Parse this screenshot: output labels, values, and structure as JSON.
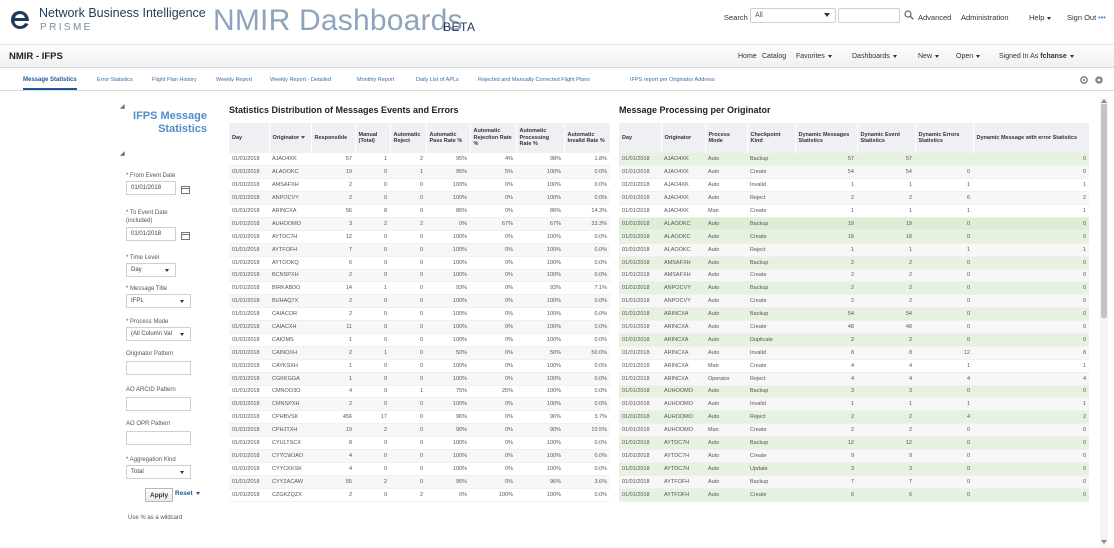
{
  "header": {
    "brand_name": "Network Business Intelligence",
    "brand_sub": "PRISME",
    "app_title": "NMIR Dashboards",
    "app_beta": "BETA",
    "search_label": "Search",
    "search_scope": "All",
    "advanced": "Advanced",
    "administration": "Administration",
    "help": "Help",
    "sign_out": "Sign Out",
    "more": "•••"
  },
  "nav": {
    "page_name": "NMIR - IFPS",
    "home": "Home",
    "catalog": "Catalog",
    "favorites": "Favorites",
    "dashboards": "Dashboards",
    "new": "New",
    "open": "Open",
    "signed_in_as": "Signed In As",
    "user": "fchanse"
  },
  "tabs": [
    "Message Statistics",
    "Error Statistics",
    "Flight Plan History",
    "Weekly Report",
    "Weekly Report - Detailed",
    "Monthly Report",
    "Daily List of APLs",
    "Rejected and Manually Corrected Flight Plans",
    "IFPS report per Originator Address"
  ],
  "filters": {
    "title_line1": "IFPS Message",
    "title_line2": "Statistics",
    "from_label": "* From Event Date",
    "from_value": "01/01/2018",
    "to_label_1": "* To Event Date",
    "to_label_2": "(included)",
    "to_value": "01/01/2018",
    "time_level_label": "* Time Level",
    "time_level_value": "Day",
    "message_title_label": "* Message Title",
    "message_title_value": "IFPL",
    "process_mode_label": "* Process Mode",
    "process_mode_value": "(All Column Val",
    "originator_label": "Originator Pattern",
    "arcid_label": "AO ARCID Pattern",
    "opr_label": "AO OPR Pattern",
    "aggregation_label": "* Aggregation Kind",
    "aggregation_value": "Total",
    "apply": "Apply",
    "reset": "Reset",
    "hint": "Use % as a wildcard"
  },
  "table1": {
    "title": "Statistics Distribution of Messages Events and Errors",
    "headers": [
      "Day",
      "Originator",
      "Responsible",
      "Manual (Total)",
      "Automatic Reject",
      "Automatic Pass Rate %",
      "Automatic Rejection Rate %",
      "Automatic Processing Rate %",
      "Automatic Invalid Rate %"
    ],
    "rows": [
      [
        "01/01/2018",
        "AJAO4XK",
        "57",
        "1",
        "2",
        "95%",
        "4%",
        "98%",
        "1.8%"
      ],
      [
        "01/01/2018",
        "ALAOOKC",
        "19",
        "0",
        "1",
        "95%",
        "5%",
        "100%",
        "0.0%"
      ],
      [
        "01/01/2018",
        "AMSAFXH",
        "2",
        "0",
        "0",
        "100%",
        "0%",
        "100%",
        "0.0%"
      ],
      [
        "01/01/2018",
        "ANPOCVY",
        "2",
        "0",
        "0",
        "100%",
        "0%",
        "100%",
        "0.0%"
      ],
      [
        "01/01/2018",
        "ARINCXA",
        "56",
        "8",
        "0",
        "86%",
        "0%",
        "86%",
        "14.3%"
      ],
      [
        "01/01/2018",
        "AUHOOMO",
        "3",
        "2",
        "2",
        "0%",
        "67%",
        "67%",
        "33.3%"
      ],
      [
        "01/01/2018",
        "AYTDC7H",
        "12",
        "0",
        "0",
        "100%",
        "0%",
        "100%",
        "0.0%"
      ],
      [
        "01/01/2018",
        "AYTFOFH",
        "7",
        "0",
        "0",
        "100%",
        "0%",
        "100%",
        "0.0%"
      ],
      [
        "01/01/2018",
        "AYTOOKQ",
        "6",
        "0",
        "0",
        "100%",
        "0%",
        "100%",
        "0.0%"
      ],
      [
        "01/01/2018",
        "BCNSPXH",
        "2",
        "0",
        "0",
        "100%",
        "0%",
        "100%",
        "0.0%"
      ],
      [
        "01/01/2018",
        "BIRKABDO",
        "14",
        "1",
        "0",
        "93%",
        "0%",
        "93%",
        "7.1%"
      ],
      [
        "01/01/2018",
        "BUHAQ7X",
        "2",
        "0",
        "0",
        "100%",
        "0%",
        "100%",
        "0.0%"
      ],
      [
        "01/01/2018",
        "CAIACOR",
        "2",
        "0",
        "0",
        "100%",
        "0%",
        "100%",
        "0.0%"
      ],
      [
        "01/01/2018",
        "CAIACXH",
        "11",
        "0",
        "0",
        "100%",
        "0%",
        "100%",
        "0.0%"
      ],
      [
        "01/01/2018",
        "CAIOMS",
        "1",
        "0",
        "0",
        "100%",
        "0%",
        "100%",
        "0.0%"
      ],
      [
        "01/01/2018",
        "CAINOXH",
        "2",
        "1",
        "0",
        "50%",
        "0%",
        "50%",
        "50.0%"
      ],
      [
        "01/01/2018",
        "CAYKSXH",
        "1",
        "0",
        "0",
        "100%",
        "0%",
        "100%",
        "0.0%"
      ],
      [
        "01/01/2018",
        "CGKKGGA",
        "1",
        "0",
        "0",
        "100%",
        "0%",
        "100%",
        "0.0%"
      ],
      [
        "01/01/2018",
        "CMNOO3O",
        "4",
        "0",
        "1",
        "75%",
        "25%",
        "100%",
        "0.0%"
      ],
      [
        "01/01/2018",
        "CMNSPXH",
        "2",
        "0",
        "0",
        "100%",
        "0%",
        "100%",
        "0.0%"
      ],
      [
        "01/01/2018",
        "CPHBVSK",
        "456",
        "17",
        "0",
        "96%",
        "0%",
        "96%",
        "3.7%"
      ],
      [
        "01/01/2018",
        "CPHJTXH",
        "19",
        "2",
        "0",
        "90%",
        "0%",
        "90%",
        "10.5%"
      ],
      [
        "01/01/2018",
        "CYULTSCX",
        "8",
        "0",
        "0",
        "100%",
        "0%",
        "100%",
        "0.0%"
      ],
      [
        "01/01/2018",
        "CYYCWJAO",
        "4",
        "0",
        "0",
        "100%",
        "0%",
        "100%",
        "0.0%"
      ],
      [
        "01/01/2018",
        "CYYCKKSK",
        "4",
        "0",
        "0",
        "100%",
        "0%",
        "100%",
        "0.0%"
      ],
      [
        "01/01/2018",
        "CYYZACAW",
        "55",
        "2",
        "0",
        "96%",
        "0%",
        "96%",
        "3.6%"
      ],
      [
        "01/01/2018",
        "CZGKZQZX",
        "2",
        "0",
        "2",
        "0%",
        "100%",
        "100%",
        "0.0%"
      ]
    ]
  },
  "table2": {
    "title": "Message Processing per Originator",
    "headers": [
      "Day",
      "Originator",
      "Process Mode",
      "Checkpoint Kind",
      "Dynamic Messages Statistics",
      "Dynamic Event Statistics",
      "Dynamic Errors Statistics",
      "Dynamic Message with error Statistics"
    ],
    "rows": [
      [
        "01/01/2018",
        "AJAO4XK",
        "Auto",
        "Backup",
        "57",
        "57",
        "",
        "0"
      ],
      [
        "01/01/2018",
        "AJAO4XK",
        "Auto",
        "Create",
        "54",
        "54",
        "0",
        "0"
      ],
      [
        "01/01/2018",
        "AJAO4XK",
        "Auto",
        "Invalid",
        "1",
        "1",
        "1",
        "1"
      ],
      [
        "01/01/2018",
        "AJAO4XK",
        "Auto",
        "Reject",
        "2",
        "2",
        "6",
        "2"
      ],
      [
        "01/01/2018",
        "AJAO4XK",
        "Man",
        "Create",
        "1",
        "1",
        "1",
        "1"
      ],
      [
        "01/01/2018",
        "ALAOOKC",
        "Auto",
        "Backup",
        "19",
        "19",
        "0",
        "0"
      ],
      [
        "01/01/2018",
        "ALAOOKC",
        "Auto",
        "Create",
        "18",
        "18",
        "0",
        "0"
      ],
      [
        "01/01/2018",
        "ALAOOKC",
        "Auto",
        "Reject",
        "1",
        "1",
        "1",
        "1"
      ],
      [
        "01/01/2018",
        "AMSAFXH",
        "Auto",
        "Backup",
        "2",
        "2",
        "0",
        "0"
      ],
      [
        "01/01/2018",
        "AMSAFXH",
        "Auto",
        "Create",
        "2",
        "2",
        "0",
        "0"
      ],
      [
        "01/01/2018",
        "ANPOCVY",
        "Auto",
        "Backup",
        "2",
        "2",
        "0",
        "0"
      ],
      [
        "01/01/2018",
        "ANPOCVY",
        "Auto",
        "Create",
        "2",
        "2",
        "0",
        "0"
      ],
      [
        "01/01/2018",
        "ARINCXA",
        "Auto",
        "Backup",
        "54",
        "54",
        "0",
        "0"
      ],
      [
        "01/01/2018",
        "ARINCXA",
        "Auto",
        "Create",
        "48",
        "48",
        "0",
        "0"
      ],
      [
        "01/01/2018",
        "ARINCXA",
        "Auto",
        "Duplicate",
        "2",
        "2",
        "0",
        "0"
      ],
      [
        "01/01/2018",
        "ARINCXA",
        "Auto",
        "Invalid",
        "8",
        "8",
        "12",
        "8"
      ],
      [
        "01/01/2018",
        "ARINCXA",
        "Man",
        "Create",
        "4",
        "4",
        "1",
        "1"
      ],
      [
        "01/01/2018",
        "ARINCXA",
        "Operator",
        "Reject",
        "4",
        "4",
        "4",
        "4"
      ],
      [
        "01/01/2018",
        "AUHOOMO",
        "Auto",
        "Backup",
        "3",
        "3",
        "0",
        "0"
      ],
      [
        "01/01/2018",
        "AUHOOMO",
        "Auto",
        "Invalid",
        "1",
        "1",
        "1",
        "1"
      ],
      [
        "01/01/2018",
        "AUHOOMO",
        "Auto",
        "Reject",
        "2",
        "2",
        "4",
        "2"
      ],
      [
        "01/01/2018",
        "AUHOOMO",
        "Man",
        "Create",
        "2",
        "2",
        "0",
        "0"
      ],
      [
        "01/01/2018",
        "AYTDC7H",
        "Auto",
        "Backup",
        "12",
        "12",
        "0",
        "0"
      ],
      [
        "01/01/2018",
        "AYTDC7H",
        "Auto",
        "Create",
        "9",
        "9",
        "0",
        "0"
      ],
      [
        "01/01/2018",
        "AYTDC7H",
        "Auto",
        "Update",
        "3",
        "3",
        "0",
        "0"
      ],
      [
        "01/01/2018",
        "AYTFOFH",
        "Auto",
        "Backup",
        "7",
        "7",
        "0",
        "0"
      ],
      [
        "01/01/2018",
        "AYTFOFH",
        "Auto",
        "Create",
        "6",
        "6",
        "0",
        "0"
      ]
    ],
    "highlight": [
      true,
      false,
      false,
      false,
      false,
      true,
      true,
      false,
      true,
      false,
      true,
      false,
      true,
      false,
      true,
      false,
      false,
      false,
      true,
      false,
      true,
      false,
      true,
      false,
      true,
      false,
      true
    ]
  }
}
